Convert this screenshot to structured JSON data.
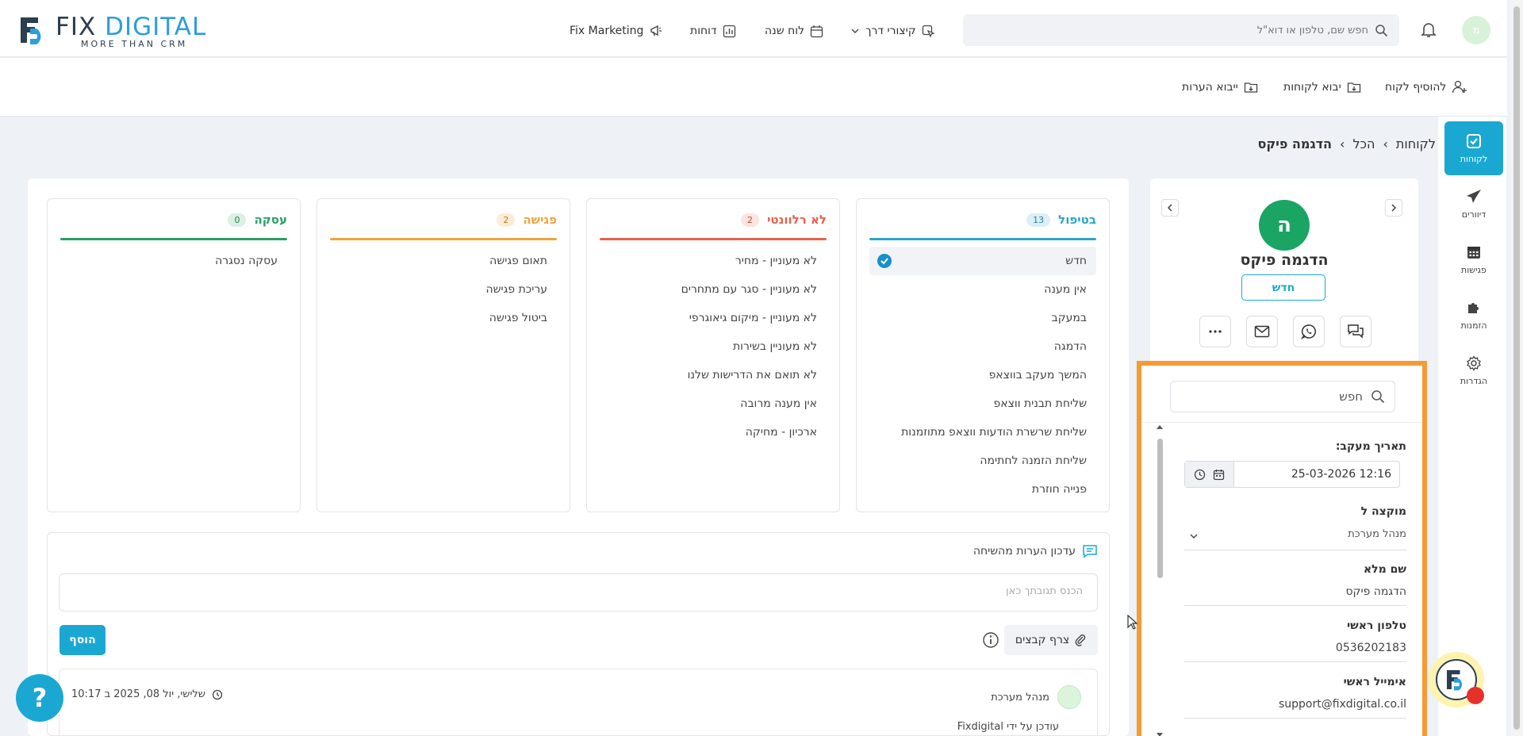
{
  "logo": {
    "brand_a": "FIX ",
    "brand_b": "DIGITAL",
    "tagline": "MORE THAN CRM"
  },
  "topnav": {
    "marketing": "Fix Marketing",
    "reports": "דוחות",
    "calendar": "לוח שנה",
    "shortcuts": "קיצורי דרך",
    "search_placeholder": "חפש שם, טלפון או דוא\"ל",
    "avatar_letter": "מ"
  },
  "actions": {
    "add_customer": "להוסיף לקוח",
    "import_customers": "יבוא לקוחות",
    "import_notes": "ייבוא הערות"
  },
  "sidebar": {
    "items": [
      {
        "label": "לקוחות",
        "icon": "checkbox-icon"
      },
      {
        "label": "דיוורים",
        "icon": "paper-plane-icon"
      },
      {
        "label": "פגישות",
        "icon": "calendar-grid-icon"
      },
      {
        "label": "הזמנות",
        "icon": "puzzle-icon"
      },
      {
        "label": "הגדרות",
        "icon": "gear-icon"
      }
    ]
  },
  "breadcrumb": {
    "root": "לקוחות",
    "mid": "הכל",
    "current": "הדגמה פיקס"
  },
  "columns": [
    {
      "title": "בטיפול",
      "count": "13",
      "color": "#2aa7c9",
      "badge_bg": "#dceef6",
      "badge_fg": "#2a7fa8",
      "items": [
        "חדש",
        "אין מענה",
        "במעקב",
        "הדמגה",
        "המשך מעקב בווצאפ",
        "שליחת תבנית ווצאפ",
        "שליחת שרשרת הודעות ווצאפ מתוזמנות",
        "שליחת הזמנה לחתימה",
        "פנייה חוזרת"
      ]
    },
    {
      "title": "לא רלוונטי",
      "count": "2",
      "color": "#e8604c",
      "badge_bg": "#fde4df",
      "badge_fg": "#c64a36",
      "items": [
        "לא מעוניין - מחיר",
        "לא מעוניין - סגר עם מתחרים",
        "לא מעוניין - מיקום גיאוגרפי",
        "לא מעוניין בשירות",
        "לא תואם את הדרישות שלנו",
        "אין מענה מרובה",
        "ארכיון - מחיקה"
      ]
    },
    {
      "title": "פגישה",
      "count": "2",
      "color": "#f2a33a",
      "badge_bg": "#fdecd5",
      "badge_fg": "#c07a1f",
      "items": [
        "תאום פגישה",
        "עריכת פגישה",
        "ביטול פגישה"
      ]
    },
    {
      "title": "עסקה",
      "count": "0",
      "color": "#28a064",
      "badge_bg": "#d9f1e3",
      "badge_fg": "#1e8050",
      "items": [
        "עסקה נסגרה"
      ]
    }
  ],
  "notes": {
    "title": "עדכון הערות מהשיחה",
    "input_placeholder": "הכנס תגובתך כאן",
    "add_button": "הוסף",
    "attach_button": "צרף קבצים",
    "entry": {
      "user": "מנהל מערכת",
      "date": "שלישי, יול 08, 2025 ב 10:17",
      "by": "עודכן על ידי Fixdigital"
    }
  },
  "contact": {
    "initial": "ה",
    "name": "הדגמה פיקס",
    "status": "חדש"
  },
  "details": {
    "search_placeholder": "חפש",
    "followup_label": "תאריך מעקב:",
    "followup_value": "25-03-2026 12:16",
    "assigned_label": "מוקצה ל",
    "assigned_value": "מנהל מערכת",
    "fullname_label": "שם מלא",
    "fullname_value": "הדגמה פיקס",
    "phone_label": "טלפון ראשי",
    "phone_value": "0536202183",
    "email_label": "אימייל ראשי",
    "email_value": "support@fixdigital.co.il"
  },
  "help": {
    "label": "?"
  },
  "colors": {
    "accent": "#1aa8d2",
    "highlight": "#f59a35",
    "avatar": "#1aa564"
  }
}
